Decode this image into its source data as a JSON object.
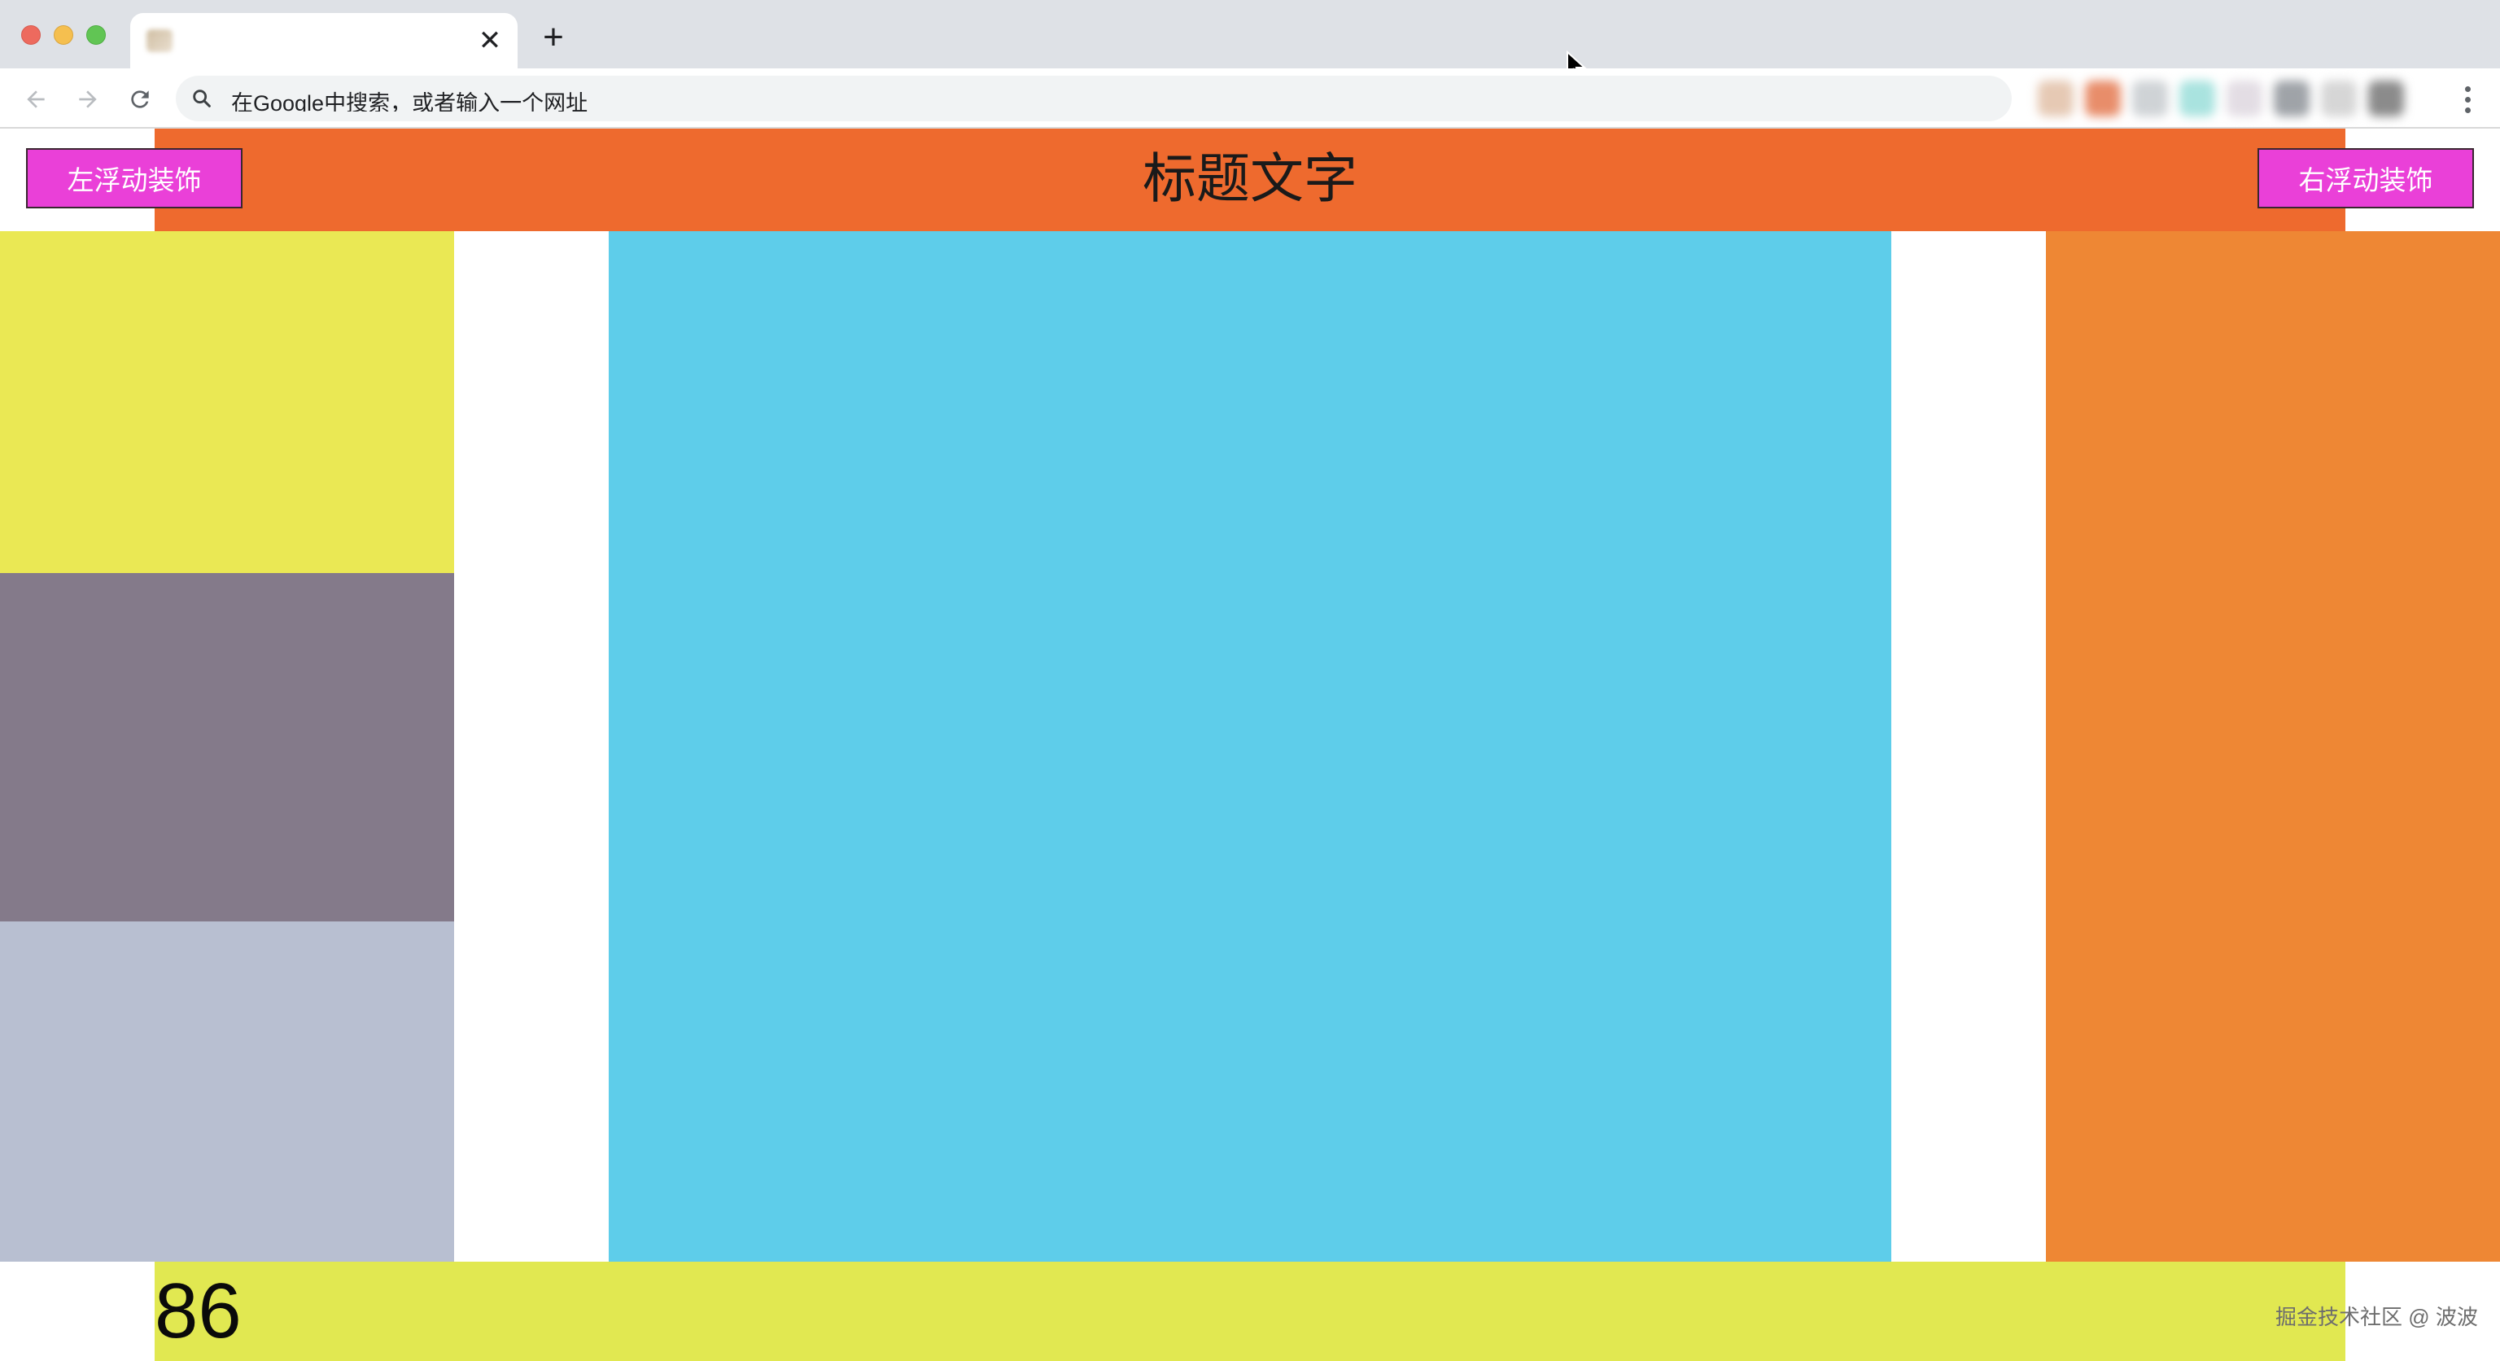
{
  "browser": {
    "tab": {
      "title": "",
      "close_glyph": "✕"
    },
    "new_tab_glyph": "+",
    "omnibox": {
      "placeholder": "在Google中搜索，或者输入一个网址"
    },
    "icons": [
      "chevron-left-icon",
      "chevron-right-icon",
      "reload-icon",
      "search-icon",
      "kebab-menu-icon"
    ]
  },
  "page": {
    "header": {
      "title": "标题文字",
      "left_button": "左浮动装饰",
      "right_button": "右浮动装饰",
      "color": "#ee6a2e"
    },
    "footer": {
      "number": "86",
      "color": "#e1e851"
    },
    "watermark": "掘金技术社区 @ 波波",
    "colors": {
      "left_top": "#eae854",
      "left_middle": "#847a8a",
      "left_bottom": "#b8bfd1",
      "main": "#5ecdea",
      "right": "#ee8734",
      "float_button": "#ea40d8"
    }
  }
}
